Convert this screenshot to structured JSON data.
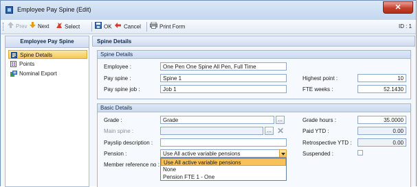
{
  "window": {
    "title": "Employee Pay Spine (Edit)",
    "close_label": "✕"
  },
  "toolbar": {
    "prev_label": "Prev",
    "next_label": "Next",
    "select_label": "Select",
    "ok_label": "OK",
    "cancel_label": "Cancel",
    "print_label": "Print Form",
    "id_label": "ID : 1"
  },
  "sidebar": {
    "title": "Employee Pay Spine",
    "items": [
      {
        "label": "Spine Details",
        "selected": true,
        "icon": "spine-details-icon"
      },
      {
        "label": "Points",
        "selected": false,
        "icon": "points-icon"
      },
      {
        "label": "Nominal Export",
        "selected": false,
        "icon": "nominal-export-icon"
      }
    ]
  },
  "main": {
    "title": "Spine Details",
    "spine_details": {
      "header": "Spine Details",
      "employee_label": "Employee :",
      "employee_value": "One Pen One Spine All Pen, Full Time",
      "pay_spine_label": "Pay spine :",
      "pay_spine_value": "Spine 1",
      "pay_spine_job_label": "Pay spine job :",
      "pay_spine_job_value": "Job 1",
      "highest_point_label": "Highest point :",
      "highest_point_value": "10",
      "fte_weeks_label": "FTE weeks :",
      "fte_weeks_value": "52.1430"
    },
    "basic_details": {
      "header": "Basic Details",
      "grade_label": "Grade :",
      "grade_value": "Grade",
      "main_spine_label": "Main spine :",
      "main_spine_value": "",
      "payslip_label": "Payslip description :",
      "payslip_value": "",
      "pension_label": "Pension :",
      "pension_value": "Use All active variable pensions",
      "member_ref_label": "Member reference no :",
      "grade_hours_label": "Grade hours :",
      "grade_hours_value": "35.0000",
      "paid_ytd_label": "Paid YTD :",
      "paid_ytd_value": "0.00",
      "retro_ytd_label": "Retrospective YTD :",
      "retro_ytd_value": "0.00",
      "suspended_label": "Suspended :",
      "suspended_checked": false,
      "dots_label": "...",
      "pension_options": [
        "Use All active variable pensions",
        "None",
        "Pension FTE 1 - One"
      ]
    }
  }
}
